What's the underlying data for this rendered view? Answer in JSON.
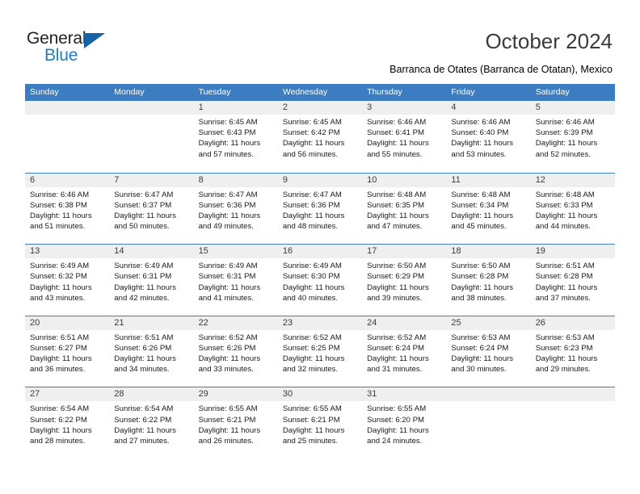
{
  "logo": {
    "word_one": "General",
    "word_two": "Blue",
    "triangle_icon": "triangle-icon",
    "accent_color": "#1463a5"
  },
  "header": {
    "title": "October 2024",
    "subtitle": "Barranca de Otates (Barranca de Otatan), Mexico"
  },
  "calendar": {
    "header_bg": "#3b7dc0",
    "daynum_bg": "#efefef",
    "weekdays": [
      "Sunday",
      "Monday",
      "Tuesday",
      "Wednesday",
      "Thursday",
      "Friday",
      "Saturday"
    ],
    "weeks": [
      [
        {
          "day": "",
          "lines": []
        },
        {
          "day": "",
          "lines": []
        },
        {
          "day": "1",
          "lines": [
            "Sunrise: 6:45 AM",
            "Sunset: 6:43 PM",
            "Daylight: 11 hours",
            "and 57 minutes."
          ]
        },
        {
          "day": "2",
          "lines": [
            "Sunrise: 6:45 AM",
            "Sunset: 6:42 PM",
            "Daylight: 11 hours",
            "and 56 minutes."
          ]
        },
        {
          "day": "3",
          "lines": [
            "Sunrise: 6:46 AM",
            "Sunset: 6:41 PM",
            "Daylight: 11 hours",
            "and 55 minutes."
          ]
        },
        {
          "day": "4",
          "lines": [
            "Sunrise: 6:46 AM",
            "Sunset: 6:40 PM",
            "Daylight: 11 hours",
            "and 53 minutes."
          ]
        },
        {
          "day": "5",
          "lines": [
            "Sunrise: 6:46 AM",
            "Sunset: 6:39 PM",
            "Daylight: 11 hours",
            "and 52 minutes."
          ]
        }
      ],
      [
        {
          "day": "6",
          "lines": [
            "Sunrise: 6:46 AM",
            "Sunset: 6:38 PM",
            "Daylight: 11 hours",
            "and 51 minutes."
          ]
        },
        {
          "day": "7",
          "lines": [
            "Sunrise: 6:47 AM",
            "Sunset: 6:37 PM",
            "Daylight: 11 hours",
            "and 50 minutes."
          ]
        },
        {
          "day": "8",
          "lines": [
            "Sunrise: 6:47 AM",
            "Sunset: 6:36 PM",
            "Daylight: 11 hours",
            "and 49 minutes."
          ]
        },
        {
          "day": "9",
          "lines": [
            "Sunrise: 6:47 AM",
            "Sunset: 6:36 PM",
            "Daylight: 11 hours",
            "and 48 minutes."
          ]
        },
        {
          "day": "10",
          "lines": [
            "Sunrise: 6:48 AM",
            "Sunset: 6:35 PM",
            "Daylight: 11 hours",
            "and 47 minutes."
          ]
        },
        {
          "day": "11",
          "lines": [
            "Sunrise: 6:48 AM",
            "Sunset: 6:34 PM",
            "Daylight: 11 hours",
            "and 45 minutes."
          ]
        },
        {
          "day": "12",
          "lines": [
            "Sunrise: 6:48 AM",
            "Sunset: 6:33 PM",
            "Daylight: 11 hours",
            "and 44 minutes."
          ]
        }
      ],
      [
        {
          "day": "13",
          "lines": [
            "Sunrise: 6:49 AM",
            "Sunset: 6:32 PM",
            "Daylight: 11 hours",
            "and 43 minutes."
          ]
        },
        {
          "day": "14",
          "lines": [
            "Sunrise: 6:49 AM",
            "Sunset: 6:31 PM",
            "Daylight: 11 hours",
            "and 42 minutes."
          ]
        },
        {
          "day": "15",
          "lines": [
            "Sunrise: 6:49 AM",
            "Sunset: 6:31 PM",
            "Daylight: 11 hours",
            "and 41 minutes."
          ]
        },
        {
          "day": "16",
          "lines": [
            "Sunrise: 6:49 AM",
            "Sunset: 6:30 PM",
            "Daylight: 11 hours",
            "and 40 minutes."
          ]
        },
        {
          "day": "17",
          "lines": [
            "Sunrise: 6:50 AM",
            "Sunset: 6:29 PM",
            "Daylight: 11 hours",
            "and 39 minutes."
          ]
        },
        {
          "day": "18",
          "lines": [
            "Sunrise: 6:50 AM",
            "Sunset: 6:28 PM",
            "Daylight: 11 hours",
            "and 38 minutes."
          ]
        },
        {
          "day": "19",
          "lines": [
            "Sunrise: 6:51 AM",
            "Sunset: 6:28 PM",
            "Daylight: 11 hours",
            "and 37 minutes."
          ]
        }
      ],
      [
        {
          "day": "20",
          "lines": [
            "Sunrise: 6:51 AM",
            "Sunset: 6:27 PM",
            "Daylight: 11 hours",
            "and 36 minutes."
          ]
        },
        {
          "day": "21",
          "lines": [
            "Sunrise: 6:51 AM",
            "Sunset: 6:26 PM",
            "Daylight: 11 hours",
            "and 34 minutes."
          ]
        },
        {
          "day": "22",
          "lines": [
            "Sunrise: 6:52 AM",
            "Sunset: 6:26 PM",
            "Daylight: 11 hours",
            "and 33 minutes."
          ]
        },
        {
          "day": "23",
          "lines": [
            "Sunrise: 6:52 AM",
            "Sunset: 6:25 PM",
            "Daylight: 11 hours",
            "and 32 minutes."
          ]
        },
        {
          "day": "24",
          "lines": [
            "Sunrise: 6:52 AM",
            "Sunset: 6:24 PM",
            "Daylight: 11 hours",
            "and 31 minutes."
          ]
        },
        {
          "day": "25",
          "lines": [
            "Sunrise: 6:53 AM",
            "Sunset: 6:24 PM",
            "Daylight: 11 hours",
            "and 30 minutes."
          ]
        },
        {
          "day": "26",
          "lines": [
            "Sunrise: 6:53 AM",
            "Sunset: 6:23 PM",
            "Daylight: 11 hours",
            "and 29 minutes."
          ]
        }
      ],
      [
        {
          "day": "27",
          "lines": [
            "Sunrise: 6:54 AM",
            "Sunset: 6:22 PM",
            "Daylight: 11 hours",
            "and 28 minutes."
          ]
        },
        {
          "day": "28",
          "lines": [
            "Sunrise: 6:54 AM",
            "Sunset: 6:22 PM",
            "Daylight: 11 hours",
            "and 27 minutes."
          ]
        },
        {
          "day": "29",
          "lines": [
            "Sunrise: 6:55 AM",
            "Sunset: 6:21 PM",
            "Daylight: 11 hours",
            "and 26 minutes."
          ]
        },
        {
          "day": "30",
          "lines": [
            "Sunrise: 6:55 AM",
            "Sunset: 6:21 PM",
            "Daylight: 11 hours",
            "and 25 minutes."
          ]
        },
        {
          "day": "31",
          "lines": [
            "Sunrise: 6:55 AM",
            "Sunset: 6:20 PM",
            "Daylight: 11 hours",
            "and 24 minutes."
          ]
        },
        {
          "day": "",
          "lines": []
        },
        {
          "day": "",
          "lines": []
        }
      ]
    ]
  }
}
